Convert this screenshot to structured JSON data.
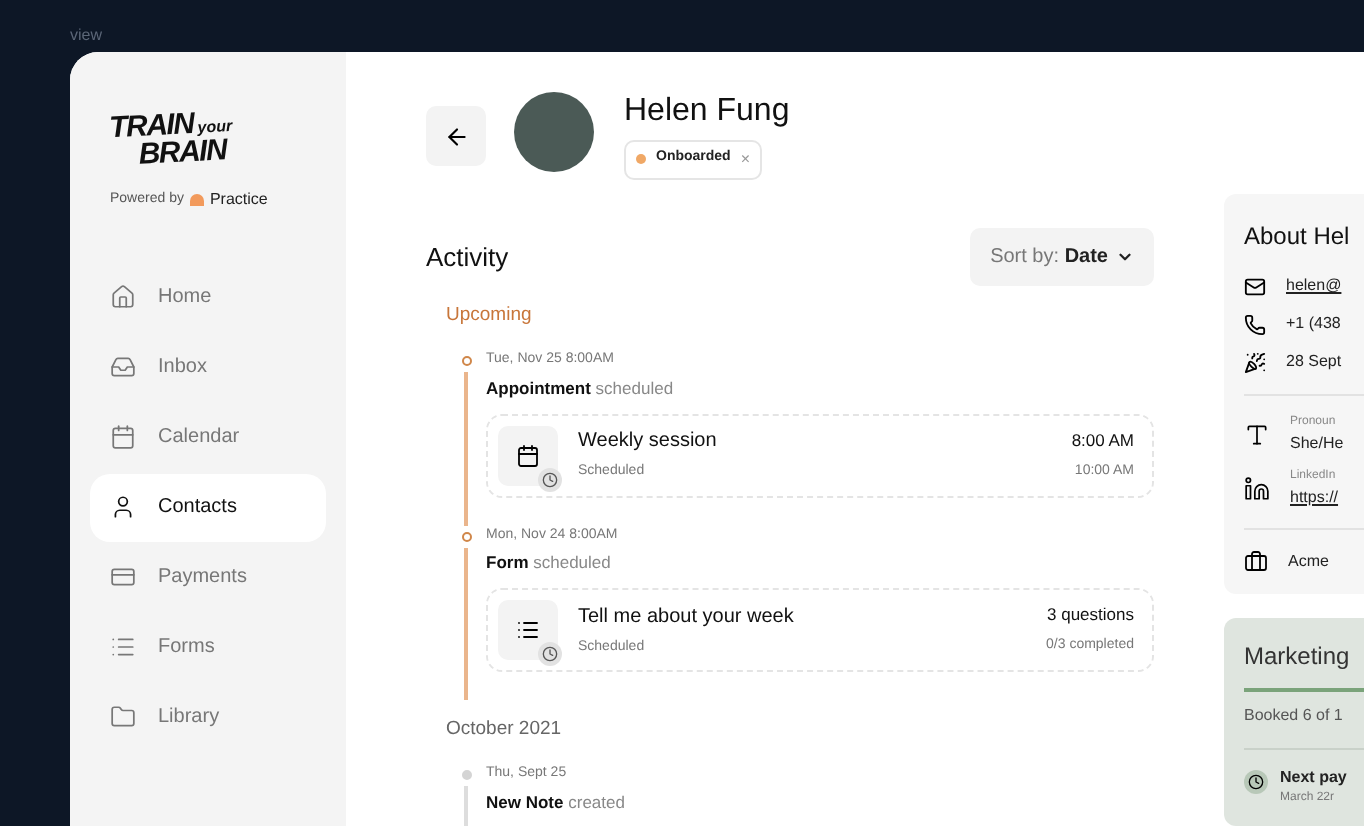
{
  "frame_label": "view",
  "brand": {
    "logo_top": "TRAIN",
    "logo_small": "your",
    "logo_bottom": "BRAIN",
    "powered_by": "Powered by",
    "powered_name": "Practice"
  },
  "sidebar": {
    "items": [
      {
        "label": "Home",
        "selected": false
      },
      {
        "label": "Inbox",
        "selected": false
      },
      {
        "label": "Calendar",
        "selected": false
      },
      {
        "label": "Contacts",
        "selected": true
      },
      {
        "label": "Payments",
        "selected": false
      },
      {
        "label": "Forms",
        "selected": false
      },
      {
        "label": "Library",
        "selected": false
      }
    ]
  },
  "contact": {
    "name": "Helen Fung",
    "status": {
      "label": "Onboarded",
      "color": "#f0a866",
      "remove": "×"
    }
  },
  "activity": {
    "title": "Activity",
    "sort_label": "Sort by:",
    "sort_value": "Date",
    "groups": [
      {
        "title": "Upcoming",
        "kind": "upcoming",
        "entries": [
          {
            "date": "Tue, Nov 25 8:00AM",
            "subject": "Appointment",
            "action": "scheduled",
            "card": {
              "kind": "appointment",
              "title": "Weekly session",
              "status": "Scheduled",
              "right_top": "8:00 AM",
              "right_bottom": "10:00 AM"
            }
          },
          {
            "date": "Mon, Nov 24 8:00AM",
            "subject": "Form",
            "action": "scheduled",
            "card": {
              "kind": "form",
              "title": "Tell me about your week",
              "status": "Scheduled",
              "right_top": "3 questions",
              "right_bottom": "0/3 completed"
            }
          }
        ]
      },
      {
        "title": "October 2021",
        "kind": "past",
        "entries": [
          {
            "date": "Thu, Sept 25",
            "subject": "New Note",
            "action": "created"
          }
        ]
      }
    ]
  },
  "about": {
    "title": "About Hel",
    "contacts": [
      {
        "value": "helen@",
        "link": true
      },
      {
        "value": "+1 (438",
        "link": false
      },
      {
        "value": "28 Sept",
        "link": false
      }
    ],
    "fields": [
      {
        "label": "Pronoun",
        "value": "She/He",
        "link": false
      },
      {
        "label": "LinkedIn",
        "value": "https://",
        "link": true
      }
    ],
    "company": {
      "value": "Acme"
    }
  },
  "marketing": {
    "title": "Marketing",
    "booked": "Booked 6 of 1",
    "next_title": "Next pay",
    "next_date": "March 22r"
  }
}
